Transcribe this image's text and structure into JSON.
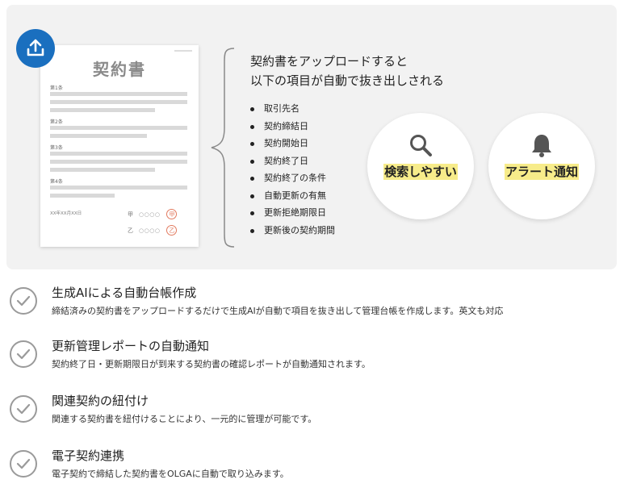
{
  "hero": {
    "upload_icon": "upload-icon",
    "document": {
      "title": "契約書",
      "sections": [
        "第1条",
        "第2条",
        "第3条",
        "第4条"
      ],
      "date": "XX年XX月XX日",
      "party_a": "甲",
      "party_b": "乙",
      "signature_placeholder": "○○○○",
      "seal_a": "甲",
      "seal_b": "乙"
    },
    "heading_line1": "契約書をアップロードすると",
    "heading_line2": "以下の項目が自動で抜き出しされる",
    "items": [
      "取引先名",
      "契約締結日",
      "契約開始日",
      "契約終了日",
      "契約終了の条件",
      "自動更新の有無",
      "更新拒絶期限日",
      "更新後の契約期間"
    ],
    "circles": [
      {
        "icon": "search-icon",
        "label": "検索しやすい"
      },
      {
        "icon": "bell-icon",
        "label": "アラート通知"
      }
    ],
    "colors": {
      "accent": "#1a6fbf",
      "highlight": "#f7ec8a",
      "seal": "#e27a5f",
      "panel": "#f2f2f2"
    }
  },
  "features": [
    {
      "icon": "check-icon",
      "title": "生成AIによる自動台帳作成",
      "desc": "締結済みの契約書をアップロードするだけで生成AIが自動で項目を抜き出して管理台帳を作成します。英文も対応"
    },
    {
      "icon": "check-icon",
      "title": "更新管理レポートの自動通知",
      "desc": "契約終了日・更新期限日が到来する契約書の確認レポートが自動通知されます。"
    },
    {
      "icon": "check-icon",
      "title": "関連契約の紐付け",
      "desc": "関連する契約書を紐付けることにより、一元的に管理が可能です。"
    },
    {
      "icon": "check-icon",
      "title": "電子契約連携",
      "desc": "電子契約で締結した契約書をOLGAに自動で取り込みます。"
    }
  ]
}
